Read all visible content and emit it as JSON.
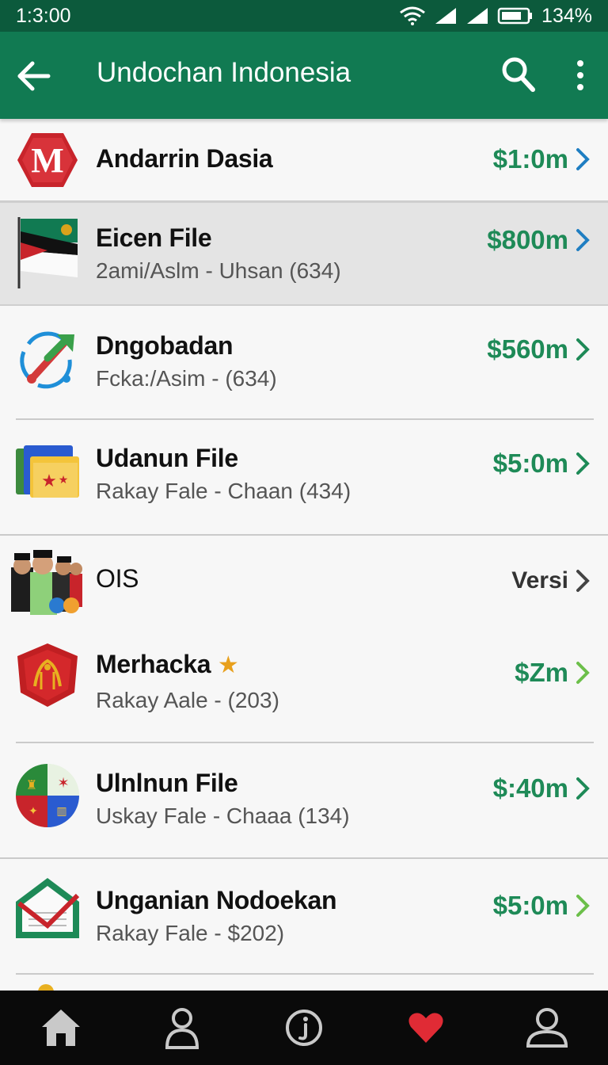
{
  "status_bar": {
    "time": "1:3:00",
    "battery": "134%"
  },
  "app_bar": {
    "title": "Undochan Indonesia",
    "back_icon": "arrow-left-icon",
    "search_icon": "search-icon",
    "menu_icon": "more-vert-icon"
  },
  "list": {
    "items": [
      {
        "title": "Andarrin Dasia",
        "subtitle": "",
        "price": "$1:0m",
        "icon": "red-hexagon-m-logo"
      },
      {
        "title": "Eicen File",
        "subtitle": "2ami/Aslm - Uhsan (634)",
        "price": "$800m",
        "icon": "flag-icon",
        "selected": true
      },
      {
        "title": "Dngobadan",
        "subtitle": "Fcka:/Asim - (634)",
        "price": "$560m",
        "icon": "sync-arrows-icon"
      },
      {
        "title": "Udanun File",
        "subtitle": "Rakay Fale - Chaan  (434)",
        "price": "$5:0m",
        "icon": "folder-stars-icon"
      },
      {
        "title": "OIS",
        "subtitle": "",
        "price": "Versi",
        "icon": "people-group-icon"
      },
      {
        "title": "Merhacka",
        "subtitle": "Rakay Aale - (203)",
        "price": "$Zm",
        "icon": "red-emblem-icon",
        "badge_icon": "star-icon"
      },
      {
        "title": "Ulnlnun File",
        "subtitle": "Uskay Fale - Chaaa  (134)",
        "price": "$:40m",
        "icon": "crest-circle-icon"
      },
      {
        "title": "Unganian Nodoekan",
        "subtitle": "Rakay Fale - $202)",
        "price": "$5:0m",
        "icon": "mail-house-icon"
      }
    ]
  },
  "bottom_nav": {
    "items": [
      "home-icon",
      "profile-icon",
      "info-icon",
      "heart-icon",
      "account-icon"
    ]
  },
  "colors": {
    "status_bar": "#0c5a3c",
    "app_bar": "#117a52",
    "price_green": "#1e8a57",
    "chevron_blue": "#1f7ec2",
    "heart_red": "#e02b35",
    "nav_bg": "#0a0a0a"
  }
}
